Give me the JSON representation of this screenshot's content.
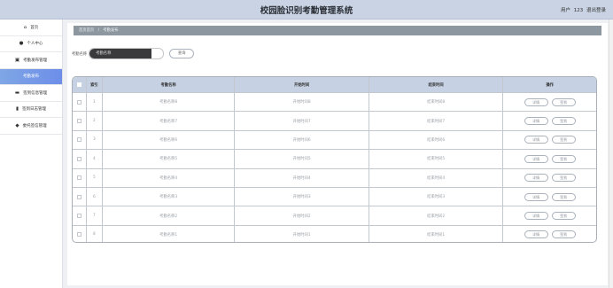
{
  "header": {
    "title": "校园脸识别考勤管理系统",
    "user_label": "用户",
    "user_name": "123",
    "logout_label": "退出登录"
  },
  "sidebar": {
    "items": [
      {
        "icon": "home-icon",
        "glyph": "⌂",
        "label": "首页"
      },
      {
        "icon": "user-icon",
        "glyph": "●",
        "label": "个人中心"
      },
      {
        "icon": "clipboard-icon",
        "glyph": "▣",
        "label": "考勤发布管理"
      },
      {
        "icon": "",
        "glyph": "",
        "label": "考勤发布"
      },
      {
        "icon": "monitor-icon",
        "glyph": "▬",
        "label": "签到信息管理"
      },
      {
        "icon": "bar-chart-icon",
        "glyph": "▮",
        "label": "签到日志管理"
      },
      {
        "icon": "tag-icon",
        "glyph": "◆",
        "label": "委托签信管理"
      }
    ],
    "active_index": 3
  },
  "breadcrumb": {
    "home": "首页首页",
    "separator": "/",
    "current": "考勤发布"
  },
  "search": {
    "label": "考勤名称",
    "placeholder": "考勤名称",
    "button_label": "查询"
  },
  "table": {
    "columns": [
      "",
      "索引",
      "考勤名称",
      "开始时间",
      "结束时间",
      "操作"
    ],
    "rows": [
      {
        "index": "1",
        "name": "考勤名称8",
        "start": "开始时间8",
        "end": "结束时间8"
      },
      {
        "index": "2",
        "name": "考勤名称7",
        "start": "开始时间7",
        "end": "结束时间7"
      },
      {
        "index": "3",
        "name": "考勤名称6",
        "start": "开始时间6",
        "end": "结束时间6"
      },
      {
        "index": "4",
        "name": "考勤名称5",
        "start": "开始时间5",
        "end": "结束时间5"
      },
      {
        "index": "5",
        "name": "考勤名称4",
        "start": "开始时间4",
        "end": "结束时间4"
      },
      {
        "index": "6",
        "name": "考勤名称3",
        "start": "开始时间3",
        "end": "结束时间3"
      },
      {
        "index": "7",
        "name": "考勤名称2",
        "start": "开始时间2",
        "end": "结束时间2"
      },
      {
        "index": "8",
        "name": "考勤名称1",
        "start": "开始时间1",
        "end": "结束时间1"
      }
    ],
    "action_detail": "详情",
    "action_signin": "签到"
  },
  "colors": {
    "header_bg": "#c9d3e3",
    "active_nav": "#6d8ee8",
    "breadcrumb_bg": "#8d979f",
    "table_head_bg": "#c6d2e3"
  }
}
